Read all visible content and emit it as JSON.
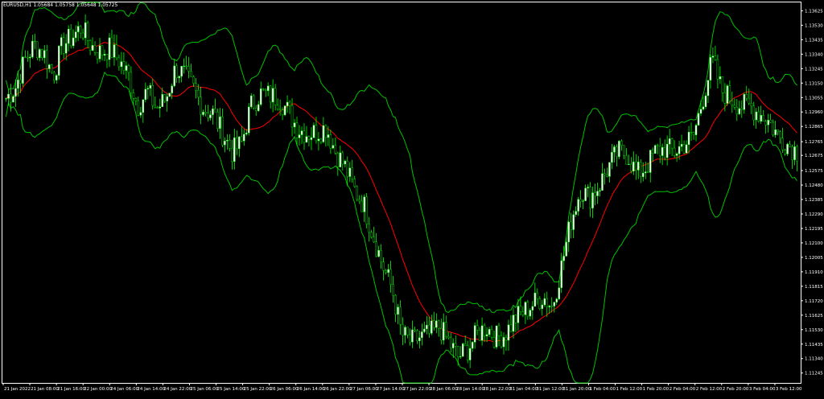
{
  "window": {
    "symbol_info": "EURUSD,H1 1.05684 1.05758 1.05648 1.05725"
  },
  "colors": {
    "background": "#000000",
    "foreground": "#ffffff",
    "bull_candle": "#ffffff",
    "bear_candle": "#000000",
    "candle_outline": "#00ff00",
    "middle_band": "#ff0000",
    "outer_bands": "#00c000"
  },
  "chart_data": {
    "type": "candlestick",
    "indicator": "Bollinger Bands",
    "ylim": [
      1.1118,
      1.1368
    ],
    "y_ticks": [
      "1.13625",
      "1.13530",
      "1.13435",
      "1.13340",
      "1.13245",
      "1.13150",
      "1.13055",
      "1.12960",
      "1.12865",
      "1.12765",
      "1.12675",
      "1.12575",
      "1.12480",
      "1.12385",
      "1.12290",
      "1.12195",
      "1.12100",
      "1.12005",
      "1.11910",
      "1.11815",
      "1.11720",
      "1.11625",
      "1.11530",
      "1.11435",
      "1.11340",
      "1.11245"
    ],
    "x_ticks": [
      "21 Jan 2022",
      "21 Jan 08:00",
      "21 Jan 16:00",
      "22 Jan 00:00",
      "24 Jan 06:00",
      "24 Jan 14:00",
      "24 Jan 22:00",
      "25 Jan 06:00",
      "25 Jan 14:00",
      "25 Jan 22:00",
      "26 Jan 06:00",
      "26 Jan 14:00",
      "26 Jan 22:00",
      "27 Jan 06:00",
      "27 Jan 14:00",
      "27 Jan 22:00",
      "28 Jan 06:00",
      "28 Jan 14:00",
      "28 Jan 22:00",
      "31 Jan 04:00",
      "31 Jan 12:00",
      "31 Jan 20:00",
      "1 Feb 04:00",
      "1 Feb 12:00",
      "1 Feb 20:00",
      "2 Feb 04:00",
      "2 Feb 12:00",
      "2 Feb 20:00",
      "3 Feb 04:00",
      "3 Feb 12:00"
    ],
    "close_path": [
      1.1305,
      1.1312,
      1.133,
      1.134,
      1.1335,
      1.132,
      1.134,
      1.1345,
      1.1352,
      1.134,
      1.1335,
      1.1338,
      1.133,
      1.132,
      1.13,
      1.131,
      1.1298,
      1.1305,
      1.1325,
      1.132,
      1.131,
      1.1298,
      1.1295,
      1.1282,
      1.127,
      1.1275,
      1.13,
      1.1308,
      1.1307,
      1.1305,
      1.1296,
      1.1285,
      1.1282,
      1.1283,
      1.1286,
      1.127,
      1.126,
      1.1245,
      1.1235,
      1.1215,
      1.1195,
      1.118,
      1.115,
      1.1145,
      1.1148,
      1.115,
      1.1155,
      1.1145,
      1.1135,
      1.114,
      1.115,
      1.1155,
      1.1148,
      1.115,
      1.116,
      1.1165,
      1.117,
      1.1175,
      1.1168,
      1.1195,
      1.1225,
      1.1245,
      1.124,
      1.1248,
      1.126,
      1.127,
      1.1268,
      1.1255,
      1.126,
      1.127,
      1.1272,
      1.127,
      1.1275,
      1.128,
      1.1305,
      1.133,
      1.131,
      1.1305,
      1.13,
      1.13,
      1.1295,
      1.129,
      1.128,
      1.1275,
      1.127
    ],
    "candles_count": 330,
    "bands_period": 20,
    "bands_deviation": 3
  }
}
